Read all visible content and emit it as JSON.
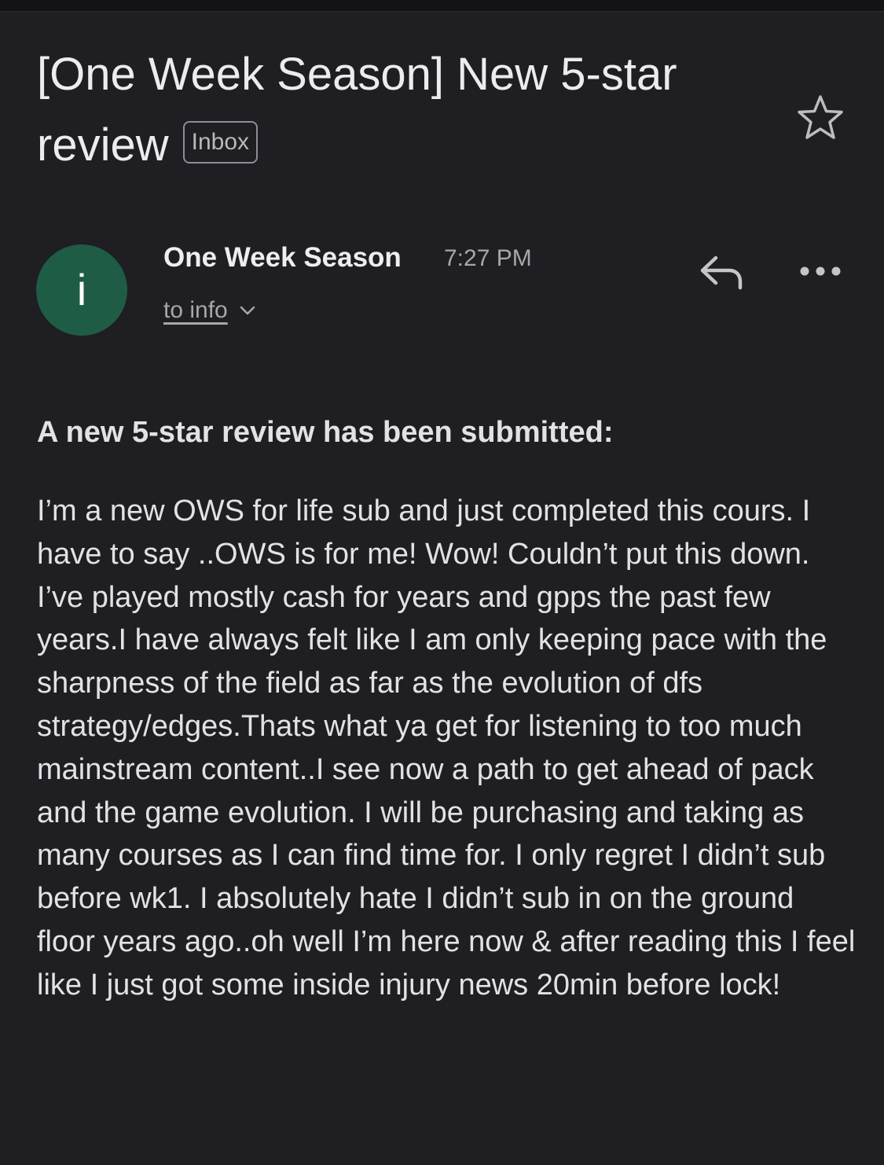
{
  "email": {
    "subject": "[One Week Season] New 5-star review",
    "label": "Inbox",
    "sender": {
      "avatar_letter": "i",
      "avatar_color": "#1f5c46",
      "name": "One Week Season",
      "time": "7:27 PM",
      "recipient": "to info"
    },
    "body_heading": "A new 5-star review has been submitted:",
    "body_text": "I’m a new OWS for life sub and just completed this cours. I have to say ..OWS is for me! Wow! Couldn’t put this down. I’ve played mostly cash for years and gpps the past few years.I have always felt like I am only keeping pace with the sharpness of the field as far as the evolution of dfs strategy/edges.Thats what ya get for listening to too much mainstream content..I see now a path to get ahead of pack and the game evolution. I will be purchasing and taking as many courses as I can find time for. I only regret I didn’t sub before wk1. I absolutely hate I didn’t sub in on the ground floor years ago..oh well I’m here now & after reading this I feel like I just got some inside injury news 20min before lock!"
  },
  "icons": {
    "star": "star-outline-icon",
    "reply": "reply-arrow-icon",
    "more": "more-horizontal-icon",
    "recipient_expand": "chevron-down-icon"
  },
  "colors": {
    "background": "#1f1e23",
    "text": "#e6e6e8",
    "muted": "#a6a6ab"
  }
}
